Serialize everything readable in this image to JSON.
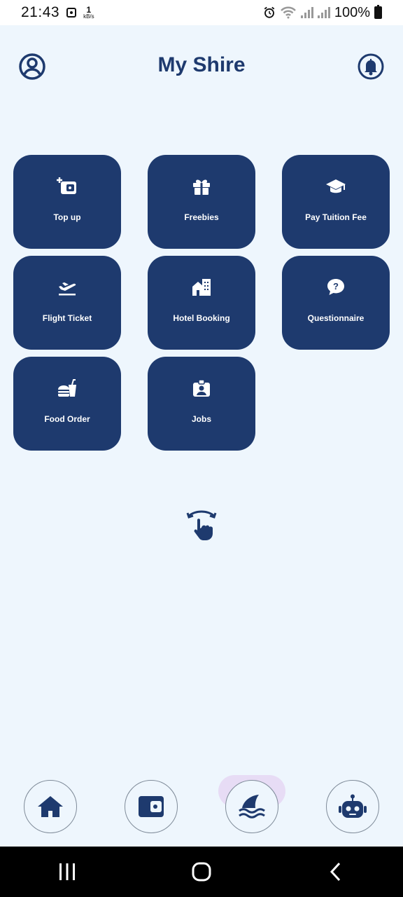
{
  "status_bar": {
    "time": "21:43",
    "data_rate_value": "1",
    "data_rate_unit": "kB/s",
    "battery": "100%"
  },
  "header": {
    "title": "My Shire",
    "profile_icon": "user-circle-icon",
    "notification_icon": "bell-icon"
  },
  "tiles": [
    {
      "label": "Top up",
      "icon": "wallet-plus-icon"
    },
    {
      "label": "Freebies",
      "icon": "gift-icon"
    },
    {
      "label": "Pay Tuition Fee",
      "icon": "graduation-cap-icon"
    },
    {
      "label": "Flight Ticket",
      "icon": "plane-departure-icon"
    },
    {
      "label": "Hotel Booking",
      "icon": "building-icon"
    },
    {
      "label": "Questionnaire",
      "icon": "question-chat-icon"
    },
    {
      "label": "Food Order",
      "icon": "burger-drink-icon"
    },
    {
      "label": "Jobs",
      "icon": "id-badge-icon"
    }
  ],
  "swipe_hint_icon": "swipe-hand-icon",
  "bottom_nav": [
    {
      "name": "home",
      "icon": "home-icon"
    },
    {
      "name": "wallet",
      "icon": "wallet-icon"
    },
    {
      "name": "shark",
      "icon": "shark-fin-icon",
      "active": true
    },
    {
      "name": "bot",
      "icon": "robot-icon"
    }
  ],
  "colors": {
    "primary": "#1e3a6e",
    "background": "#eef6fd",
    "active_highlight": "#e7dcf5"
  }
}
